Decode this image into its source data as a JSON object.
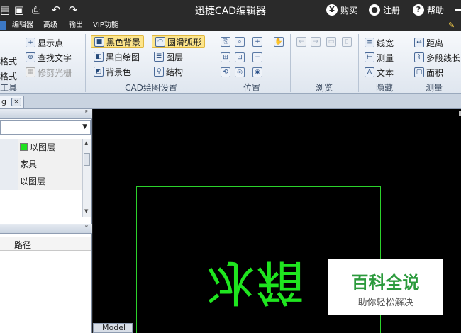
{
  "titlebar": {
    "title": "迅捷CAD编辑器",
    "buy": "购买",
    "register": "注册",
    "help": "帮助",
    "buy_icon_glyph": "¥",
    "help_icon_glyph": "?"
  },
  "menu": {
    "items": [
      "编辑器",
      "高级",
      "输出",
      "VIP功能"
    ]
  },
  "ribbon": {
    "tools_group": {
      "items": [
        "格式",
        "格式",
        "显示点",
        "查找文字",
        "修剪光栅"
      ],
      "label": "工具"
    },
    "cad_group": {
      "black_bg": "黑色背景",
      "smooth_arc": "圆滑弧形",
      "bw_draw": "黑白绘图",
      "layers": "图层",
      "bg_color": "背景色",
      "structure": "结构",
      "label": "CAD绘图设置"
    },
    "position_group": {
      "label": "位置"
    },
    "browse_group": {
      "label": "浏览"
    },
    "hide_group": {
      "line_width": "线宽",
      "measure": "测量",
      "text": "文本",
      "label": "隐藏"
    },
    "measure_group": {
      "distance": "距离",
      "polyline_length": "多段线长",
      "area": "面积",
      "label": "测量"
    },
    "text_icon_glyph": "A"
  },
  "doc_tab": {
    "name": "g",
    "close_glyph": "×"
  },
  "properties": {
    "rows": [
      "以图层",
      "家具",
      "以图层"
    ],
    "swatch_color": "#1ee11e"
  },
  "panel2": {
    "column": "路径"
  },
  "canvas": {
    "drawing_text": "冰箱",
    "model_tab": "Model",
    "line_color": "#2bd22b"
  },
  "watermark": {
    "title": "百科全说",
    "subtitle": "助你轻松解决"
  }
}
